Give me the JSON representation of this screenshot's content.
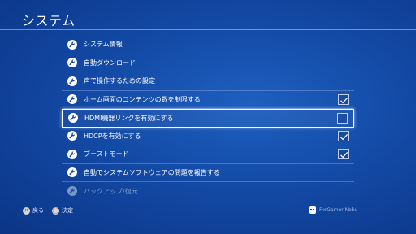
{
  "header": {
    "title": "システム"
  },
  "menu": {
    "items": [
      {
        "label": "システム情報",
        "icon": "wrench-icon",
        "checkbox": null
      },
      {
        "label": "自動ダウンロード",
        "icon": "wrench-icon",
        "checkbox": null
      },
      {
        "label": "声で操作するための設定",
        "icon": "wrench-icon",
        "checkbox": null
      },
      {
        "label": "ホーム画面のコンテンツの数を制限する",
        "icon": "wrench-icon",
        "checkbox": true
      },
      {
        "label": "HDMI機器リンクを有効にする",
        "icon": "wrench-icon",
        "checkbox": false,
        "selected": true
      },
      {
        "label": "HDCPを有効にする",
        "icon": "wrench-icon",
        "checkbox": true
      },
      {
        "label": "ブーストモード",
        "icon": "wrench-icon",
        "checkbox": true
      },
      {
        "label": "自動でシステムソフトウェアの問題を報告する",
        "icon": "wrench-icon",
        "checkbox": null
      },
      {
        "label": "バックアップ/復元",
        "icon": "wrench-icon",
        "checkbox": null
      }
    ]
  },
  "footer": {
    "back_glyph": "✕",
    "back_label": "戻る",
    "confirm_glyph": "◯",
    "confirm_label": "決定",
    "user_label": "ForGamer Nobu",
    "user_icon": "avatar-icon"
  },
  "colors": {
    "background": "#134aa6",
    "cross_button": "#4a6fd6",
    "circle_button": "#e0472e"
  }
}
